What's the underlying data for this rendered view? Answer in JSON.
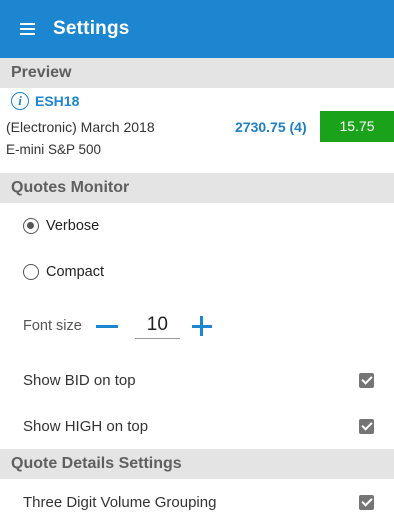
{
  "appbar": {
    "title": "Settings",
    "menu_icon": "hamburger-icon"
  },
  "preview": {
    "header": "Preview",
    "info_icon": "info-icon",
    "symbol": "ESH18",
    "description_line1": "(Electronic) March 2018",
    "description_line2": "E-mini S&P 500",
    "price": "2730.75 (4)",
    "change": "15.75",
    "change_color": "#1aa31a"
  },
  "quotes_monitor": {
    "header": "Quotes Monitor",
    "modes": [
      {
        "label": "Verbose",
        "selected": true
      },
      {
        "label": "Compact",
        "selected": false
      }
    ],
    "font_size": {
      "label": "Font size",
      "value": "10"
    },
    "show_bid_on_top": {
      "label": "Show BID on top",
      "checked": true
    },
    "show_high_on_top": {
      "label": "Show HIGH on top",
      "checked": true
    }
  },
  "quote_details": {
    "header": "Quote Details Settings",
    "three_digit_volume_grouping": {
      "label": "Three Digit Volume Grouping",
      "checked": true
    }
  },
  "colors": {
    "accent": "#1c86d1",
    "section_bg": "#e4e4e4"
  }
}
